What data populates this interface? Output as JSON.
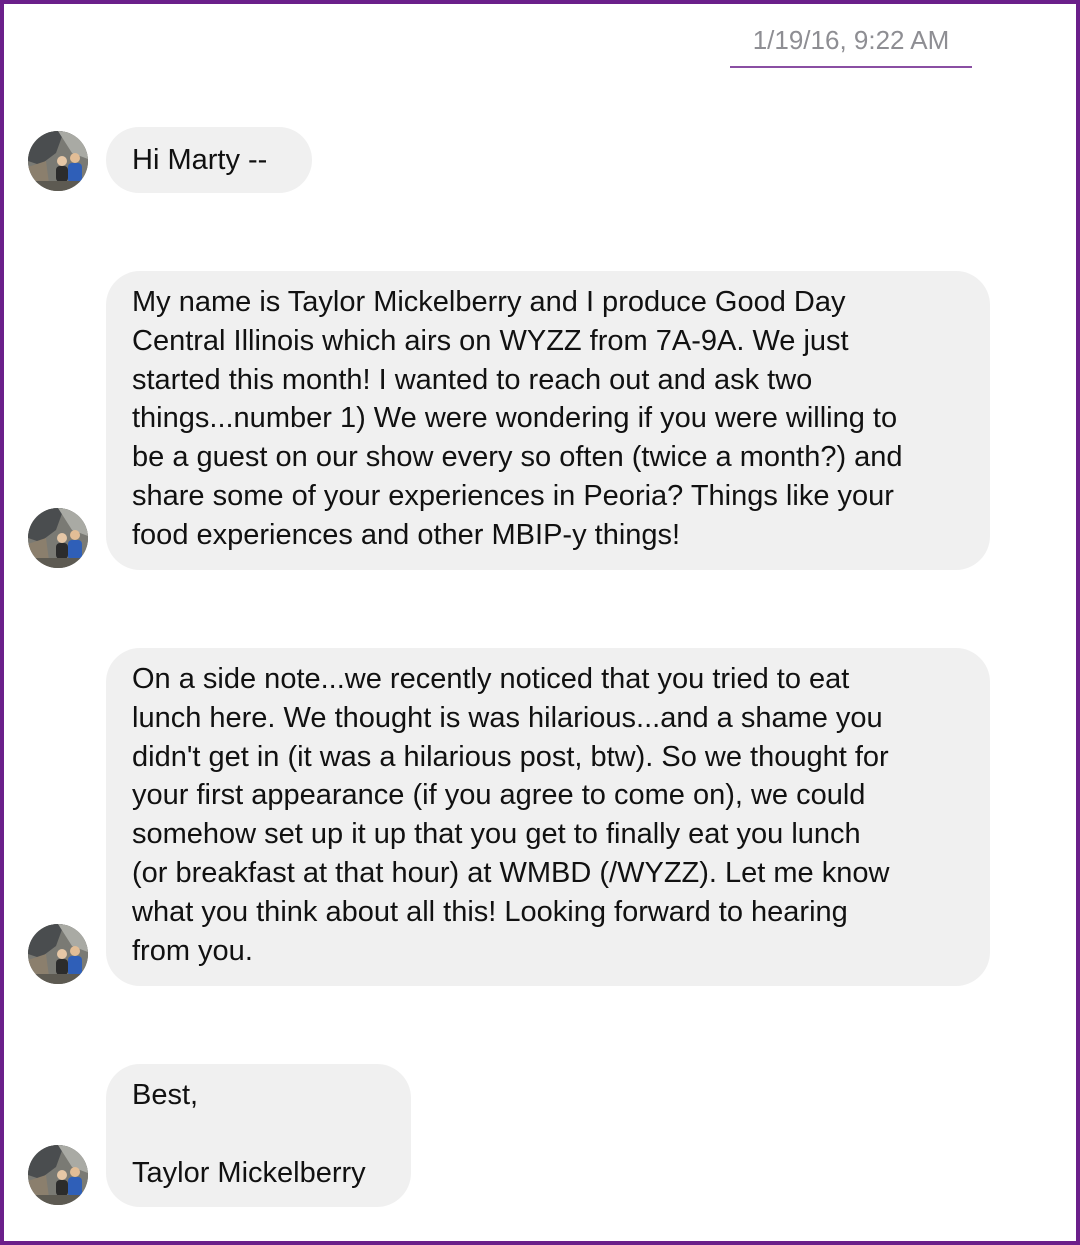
{
  "conversation": {
    "timestamp": "1/19/16, 9:22 AM",
    "messages": [
      {
        "text": "Hi Marty --"
      },
      {
        "text": "My name is Taylor Mickelberry and I produce Good Day\nCentral Illinois which airs on WYZZ from 7A-9A. We just\nstarted this month! I wanted to reach out and ask two\nthings...number 1) We were wondering if you were willing to\nbe a guest on our show every so often (twice a month?) and\nshare some of your experiences in Peoria? Things like your\nfood experiences and other MBIP-y things!"
      },
      {
        "text": "On a side note...we recently noticed that you tried to eat\nlunch here. We thought is was hilarious...and a shame you\ndidn't get in (it was a hilarious post, btw). So we thought for\nyour first appearance (if you agree to come on), we could\nsomehow set up it up that you get to finally eat you lunch\n(or breakfast at that hour) at WMBD (/WYZZ). Let me know\nwhat you think about all this! Looking forward to hearing\nfrom you."
      },
      {
        "text": "Best,\n\nTaylor Mickelberry"
      }
    ]
  },
  "colors": {
    "frame_border": "#6b1f8a",
    "bubble_background": "#f0f0f0",
    "timestamp_text": "#8e8e93",
    "timestamp_underline": "#8a4fa3"
  },
  "icons": {
    "avatar": "sender-avatar-photo"
  }
}
